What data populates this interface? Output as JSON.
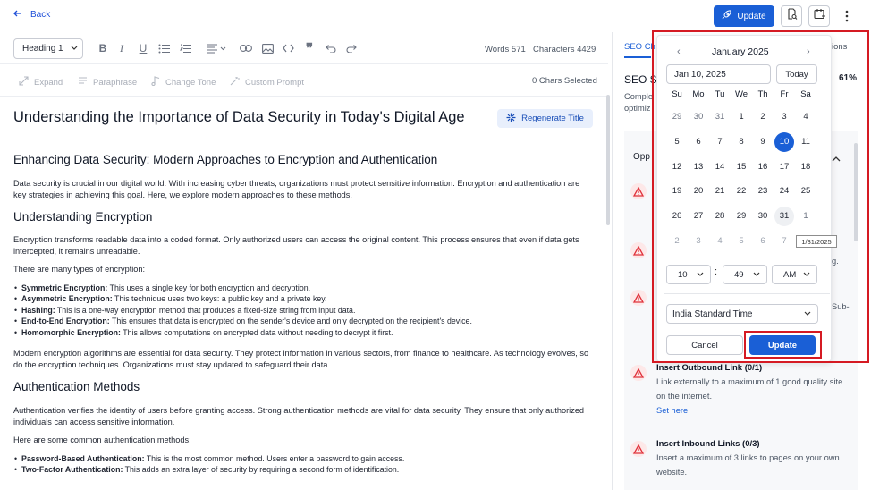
{
  "header": {
    "back_label": "Back",
    "update_label": "Update"
  },
  "toolbar": {
    "heading_select": "Heading 1",
    "words": "Words 571",
    "characters": "Characters 4429"
  },
  "ai_tools": {
    "expand": "Expand",
    "paraphrase": "Paraphrase",
    "change_tone": "Change Tone",
    "custom_prompt": "Custom Prompt",
    "chars_selected": "0 Chars Selected"
  },
  "document": {
    "title": "Understanding the Importance of Data Security in Today's Digital Age",
    "regenerate_label": "Regenerate Title",
    "h2_1": "Enhancing Data Security: Modern Approaches to Encryption and Authentication",
    "p1": "Data security is crucial in our digital world. With increasing cyber threats, organizations must protect sensitive information. Encryption and authentication are key strategies in achieving this goal. Here, we explore modern approaches to these methods.",
    "h2_2": "Understanding Encryption",
    "p2": "Encryption transforms readable data into a coded format. Only authorized users can access the original content. This process ensures that even if data gets intercepted, it remains unreadable.",
    "p3": "There are many types of encryption:",
    "enc_list": [
      {
        "term": "Symmetric Encryption:",
        "text": " This uses a single key for both encryption and decryption."
      },
      {
        "term": "Asymmetric Encryption:",
        "text": " This technique uses two keys: a public key and a private key."
      },
      {
        "term": "Hashing:",
        "text": " This is a one-way encryption method that produces a fixed-size string from input data."
      },
      {
        "term": "End-to-End Encryption:",
        "text": " This ensures that data is encrypted on the sender's device and only decrypted on the recipient's device."
      },
      {
        "term": "Homomorphic Encryption:",
        "text": " This allows computations on encrypted data without needing to decrypt it first."
      }
    ],
    "p4": "Modern encryption algorithms are essential for data security. They protect information in various sectors, from finance to healthcare. As technology evolves, so do the encryption techniques. Organizations must stay updated to safeguard their data.",
    "h2_3": "Authentication Methods",
    "p5": "Authentication verifies the identity of users before granting access. Strong authentication methods are vital for data security. They ensure that only authorized individuals can access sensitive information.",
    "p6": "Here are some common authentication methods:",
    "auth_list": [
      {
        "term": "Password-Based Authentication:",
        "text": " This is the most common method. Users enter a password to gain access."
      },
      {
        "term": "Two-Factor Authentication:",
        "text": " This adds an extra layer of security by requiring a second form of identification."
      }
    ]
  },
  "seo_panel": {
    "tab_label": "SEO Ch",
    "other_tab": "ions",
    "score_label": "SEO S",
    "score_pct": "61%",
    "desc_line1": "Comple",
    "desc_line2": "optimiz",
    "opportunities_label": "Opp",
    "frag1": "g.",
    "frag2": "Sub-",
    "tasks": [
      {
        "title": "Insert Outbound Link (0/1)",
        "desc": "Link externally to a maximum of 1 good quality site on the internet.",
        "link": "Set here"
      },
      {
        "title": "Insert Inbound Links (0/3)",
        "desc": "Insert a maximum of 3 links to pages on your own website."
      }
    ]
  },
  "datepicker": {
    "month_label": "January  2025",
    "date_value": "Jan 10, 2025",
    "today_label": "Today",
    "weekdays": [
      "Su",
      "Mo",
      "Tu",
      "We",
      "Th",
      "Fr",
      "Sa"
    ],
    "weeks": [
      [
        "29",
        "30",
        "31",
        "1",
        "2",
        "3",
        "4"
      ],
      [
        "5",
        "6",
        "7",
        "8",
        "9",
        "10",
        "11"
      ],
      [
        "12",
        "13",
        "14",
        "15",
        "16",
        "17",
        "18"
      ],
      [
        "19",
        "20",
        "21",
        "22",
        "23",
        "24",
        "25"
      ],
      [
        "26",
        "27",
        "28",
        "29",
        "30",
        "31",
        "1"
      ],
      [
        "2",
        "3",
        "4",
        "5",
        "6",
        "7",
        ""
      ]
    ],
    "selected_day": "10",
    "tooltip": "1/31/2025",
    "hour": "10",
    "minute": "49",
    "ampm": "AM",
    "timezone": "India Standard Time",
    "cancel_label": "Cancel",
    "update_label": "Update"
  },
  "colors": {
    "accent": "#1a5fd6",
    "highlight": "#d51a23",
    "warning": "#e0313a"
  }
}
